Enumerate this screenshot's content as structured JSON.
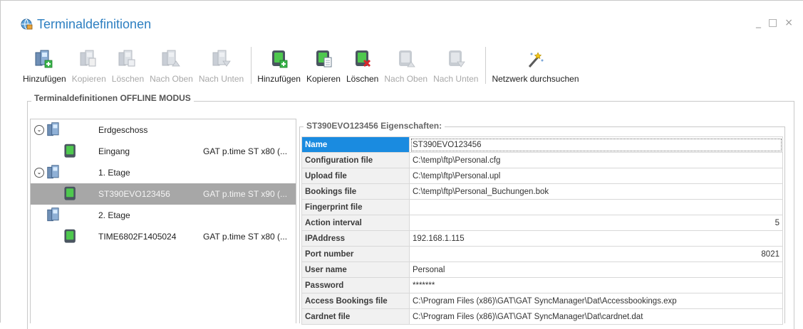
{
  "window": {
    "title": "Terminaldefinitionen",
    "controls": {
      "minimize": "_",
      "maximize": "□",
      "close": "×"
    }
  },
  "toolbar": {
    "group1": [
      {
        "label": "Hinzufügen",
        "icon": "terminal-add-icon",
        "enabled": true
      },
      {
        "label": "Kopieren",
        "icon": "terminal-copy-icon",
        "enabled": false
      },
      {
        "label": "Löschen",
        "icon": "terminal-delete-icon",
        "enabled": false
      },
      {
        "label": "Nach Oben",
        "icon": "terminal-up-icon",
        "enabled": false
      },
      {
        "label": "Nach Unten",
        "icon": "terminal-down-icon",
        "enabled": false
      }
    ],
    "group2": [
      {
        "label": "Hinzufügen",
        "icon": "device-add-icon",
        "enabled": true
      },
      {
        "label": "Kopieren",
        "icon": "device-copy-icon",
        "enabled": true
      },
      {
        "label": "Löschen",
        "icon": "device-delete-icon",
        "enabled": true
      },
      {
        "label": "Nach Oben",
        "icon": "device-up-icon",
        "enabled": false
      },
      {
        "label": "Nach Unten",
        "icon": "device-down-icon",
        "enabled": false
      }
    ],
    "group3": [
      {
        "label": "Netzwerk durchsuchen",
        "icon": "magic-wand-icon",
        "enabled": true
      }
    ]
  },
  "group": {
    "title": "Terminaldefinitionen OFFLINE MODUS"
  },
  "tree": {
    "rows": [
      {
        "name": "Erdgeschoss",
        "type": "",
        "kind": "group",
        "expander": true
      },
      {
        "name": "Eingang",
        "type": "GAT p.time ST x80 (...",
        "kind": "device"
      },
      {
        "name": "1. Etage",
        "type": "",
        "kind": "group",
        "expander": true
      },
      {
        "name": "ST390EVO123456",
        "type": "GAT p.time ST x90 (...",
        "kind": "device",
        "selected": true
      },
      {
        "name": "2. Etage",
        "type": "",
        "kind": "group",
        "expander": false
      },
      {
        "name": "TIME6802F1405024",
        "type": "GAT p.time ST x80 (...",
        "kind": "device"
      }
    ]
  },
  "properties": {
    "title": "ST390EVO123456 Eigenschaften:",
    "rows": [
      {
        "name": "Name",
        "value": "ST390EVO123456"
      },
      {
        "name": "Configuration file",
        "value": "C:\\temp\\ftp\\Personal.cfg"
      },
      {
        "name": "Upload file",
        "value": "C:\\temp\\ftp\\Personal.upl"
      },
      {
        "name": "Bookings file",
        "value": "C:\\temp\\ftp\\Personal_Buchungen.bok"
      },
      {
        "name": "Fingerprint file",
        "value": ""
      },
      {
        "name": "Action interval",
        "value": "5"
      },
      {
        "name": "IPAddress",
        "value": "192.168.1.115"
      },
      {
        "name": "Port number",
        "value": "8021"
      },
      {
        "name": "User name",
        "value": "Personal"
      },
      {
        "name": "Password",
        "value": "*******"
      },
      {
        "name": "Access Bookings file",
        "value": "C:\\Program Files (x86)\\GAT\\GAT SyncManager\\Dat\\Accessbookings.exp"
      },
      {
        "name": "Cardnet file",
        "value": "C:\\Program Files (x86)\\GAT\\GAT SyncManager\\Dat\\cardnet.dat"
      }
    ]
  },
  "colors": {
    "accent": "#2d7fc1",
    "selection": "#1a8be0",
    "tree_selection": "#a7a7a7",
    "device_green": "#3fbf3f"
  }
}
